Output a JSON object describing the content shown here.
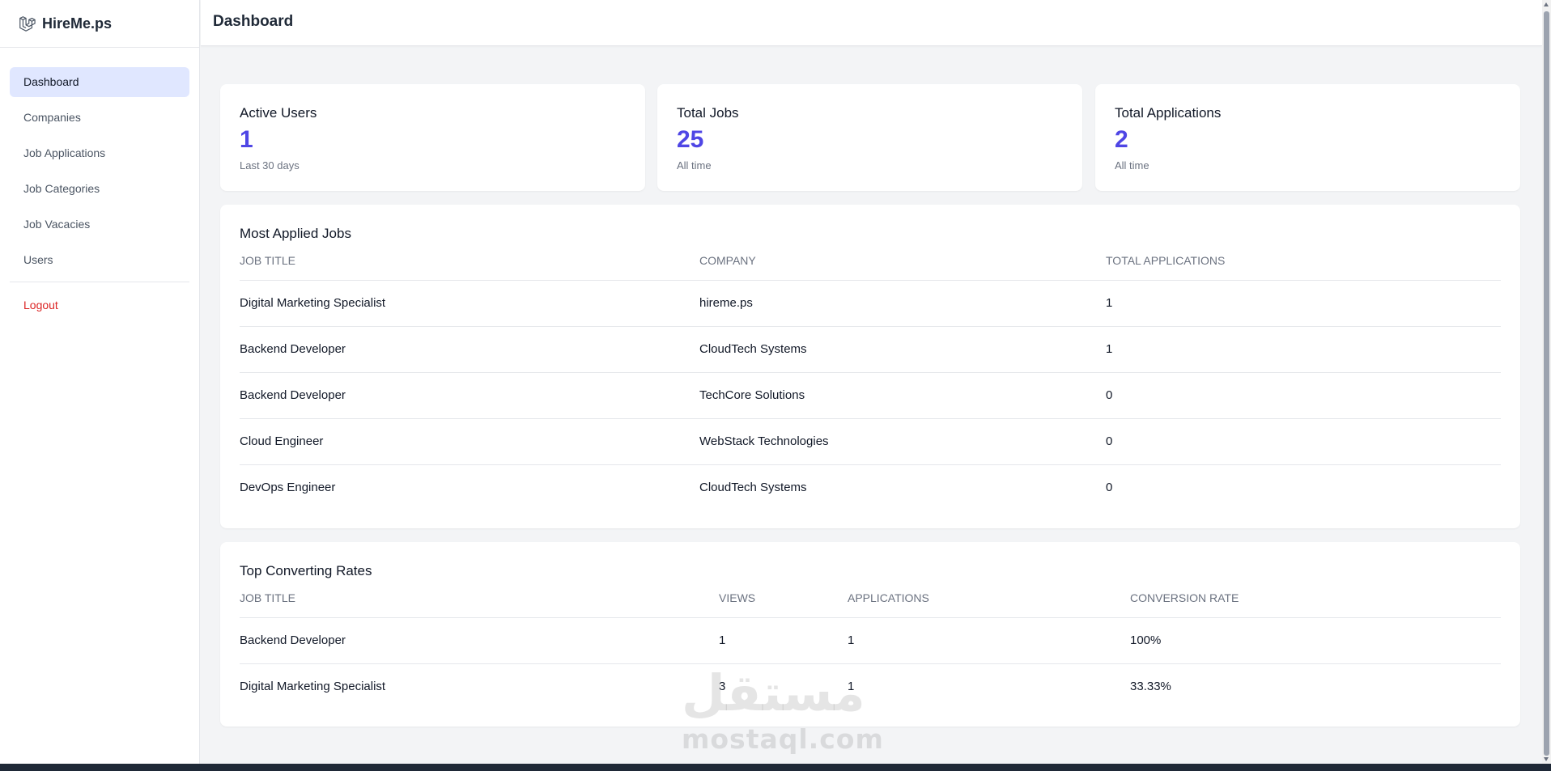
{
  "app": {
    "name": "HireMe.ps",
    "logo_icon": "laravel-logo-icon"
  },
  "header": {
    "title": "Dashboard"
  },
  "sidebar": {
    "items": [
      {
        "label": "Dashboard",
        "active": true
      },
      {
        "label": "Companies"
      },
      {
        "label": "Job Applications"
      },
      {
        "label": "Job Categories"
      },
      {
        "label": "Job Vacacies"
      },
      {
        "label": "Users"
      }
    ],
    "logout": "Logout"
  },
  "stats": [
    {
      "label": "Active Users",
      "value": "1",
      "sub": "Last 30 days"
    },
    {
      "label": "Total Jobs",
      "value": "25",
      "sub": "All time"
    },
    {
      "label": "Total Applications",
      "value": "2",
      "sub": "All time"
    }
  ],
  "most_applied": {
    "title": "Most Applied Jobs",
    "columns": [
      "JOB TITLE",
      "COMPANY",
      "TOTAL APPLICATIONS"
    ],
    "rows": [
      [
        "Digital Marketing Specialist",
        "hireme.ps",
        "1"
      ],
      [
        "Backend Developer",
        "CloudTech Systems",
        "1"
      ],
      [
        "Backend Developer",
        "TechCore Solutions",
        "0"
      ],
      [
        "Cloud Engineer",
        "WebStack Technologies",
        "0"
      ],
      [
        "DevOps Engineer",
        "CloudTech Systems",
        "0"
      ]
    ]
  },
  "top_converting": {
    "title": "Top Converting Rates",
    "columns": [
      "JOB TITLE",
      "VIEWS",
      "APPLICATIONS",
      "CONVERSION RATE"
    ],
    "rows": [
      [
        "Backend Developer",
        "1",
        "1",
        "100%"
      ],
      [
        "Digital Marketing Specialist",
        "3",
        "1",
        "33.33%"
      ]
    ]
  },
  "watermark": {
    "arabic": "مستقل",
    "latin": "mostaql.com"
  },
  "colors": {
    "accent": "#4f46e5",
    "active_bg": "#e0e7ff",
    "logout": "#dc2626",
    "logo": "#4b5563"
  }
}
